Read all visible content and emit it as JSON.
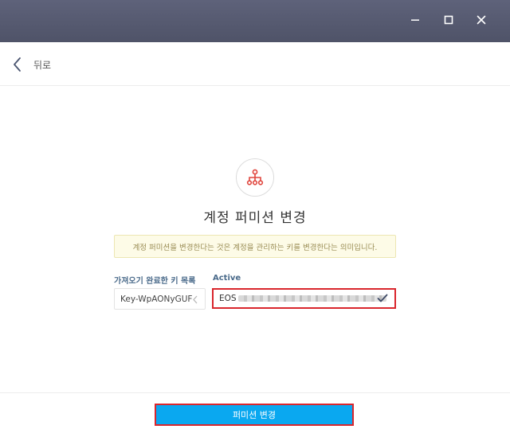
{
  "header": {
    "back_label": "뒤로"
  },
  "main": {
    "title": "계정 퍼미션 변경",
    "notice": "계정 퍼미션을 변경한다는 것은 계정을 관리하는 키를 변경한다는 의미입니다.",
    "keys_label": "가져오기 완료한 키 목록",
    "selected_key": "Key-WpAONyGUF",
    "active_label": "Active",
    "active_value_prefix": "EOS"
  },
  "footer": {
    "submit_label": "퍼미션 변경"
  },
  "colors": {
    "accent": "#0aa8f0",
    "highlight_border": "#d9262d",
    "icon_red": "#e0473f",
    "titlebar": "#565a70"
  },
  "icons": {
    "minimize": "minimize-icon",
    "maximize": "maximize-icon",
    "close": "close-icon",
    "back": "chevron-left-icon",
    "permission": "key-hierarchy-icon",
    "select_arrow": "chevron-left-icon",
    "check": "checkmark-icon"
  }
}
